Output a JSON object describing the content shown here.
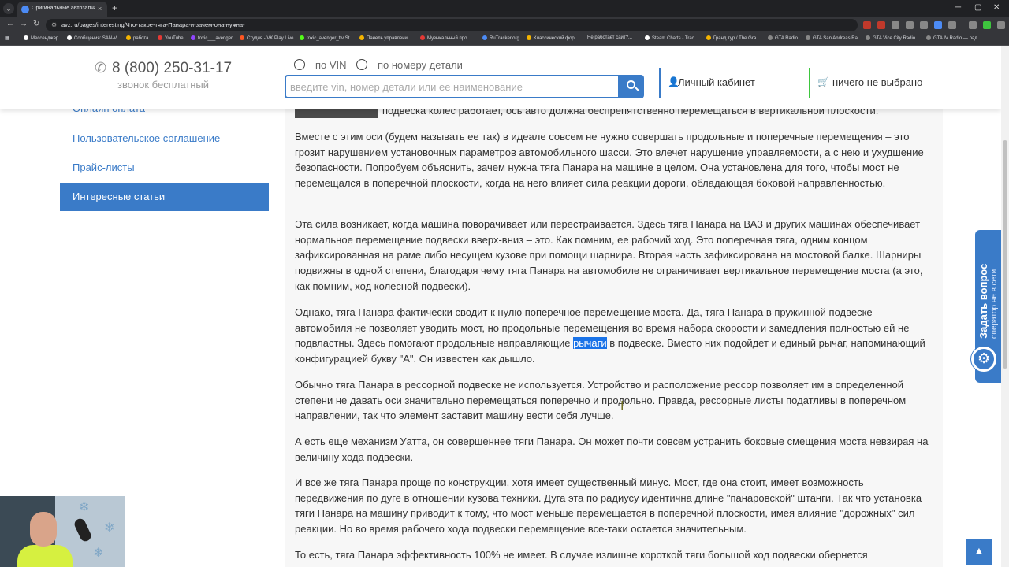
{
  "browser": {
    "tab_title": "Оригинальные автозапчасти и",
    "tab_close": "×",
    "tab_new": "+",
    "menu_glyph": "⌄",
    "url": "avz.ru/pages/interesting/Что-такое-тяга-Панара-и-зачем-она-нужна-",
    "bookmarks": [
      "Мессенджер",
      "Сообщения: SAN-V...",
      "работа",
      "YouTube",
      "toxic___avenger",
      "Студия - VK Play Live",
      "toxic_avenger_ttv St...",
      "Панель управлени...",
      "Музыкальный про...",
      "RuTracker.org",
      "Классический фор...",
      "Не работает сайт?...",
      "Steam Charts - Trac...",
      "Гранд тур / The Gra...",
      "GTA Radio",
      "GTA San Andreas Ra...",
      "GTA Vice City Radio...",
      "GTA IV Radio — рад..."
    ],
    "colors": {
      "chrome_dark": "#202124",
      "chrome_mid": "#35363a"
    }
  },
  "header": {
    "phone": "8 (800) 250-31-17",
    "phone_sub": "звонок бесплатный",
    "radio_vin": "по VIN",
    "radio_part": "по номеру детали",
    "search_placeholder": "введите vin, номер детали или ее наименование",
    "cabinet": "Личный кабинет",
    "cart": "ничего не выбрано",
    "accent": "#3a7bc8",
    "cart_accent": "#3ec63e"
  },
  "sidebar": {
    "items": [
      {
        "label": "Онлайн оплата",
        "active": false
      },
      {
        "label": "Пользовательское соглашение",
        "active": false
      },
      {
        "label": "Прайс-листы",
        "active": false
      },
      {
        "label": "Интересные статьи",
        "active": true
      }
    ]
  },
  "article": {
    "p0": "подвеска колес работает, ось авто должна беспрепятственно перемещаться в вертикальной плоскости.",
    "p1": "Вместе с этим оси (будем называть ее так) в идеале совсем не нужно совершать продольные и поперечные перемещения – это грозит нарушением установочных параметров автомобильного шасси. Это влечет нарушение управляемости, а с нею и ухудшение безопасности. Попробуем объяснить, зачем нужна тяга Панара на машине в целом. Она установлена для того, чтобы мост не перемещался в поперечной плоскости, когда на него влияет сила реакции дороги, обладающая боковой направленностью.",
    "p2": "Эта сила возникает, когда машина поворачивает или перестраивается. Здесь тяга Панара на ВАЗ и других машинах обеспечивает нормальное перемещение подвески вверх-вниз – это. Как помним, ее рабочий ход. Это поперечная тяга, одним концом зафиксированная на раме либо несущем кузове при помощи шарнира. Вторая часть зафиксирована на мостовой балке. Шарниры подвижны в одной степени, благодаря чему тяга Панара на автомобиле не ограничивает вертикальное перемещение моста (а это, как помним, ход колесной подвески).",
    "p3_before": "Однако, тяга Панара фактически сводит к нулю поперечное перемещение моста. Да, тяга Панара в пружинной подвеске автомобиля не позволяет уводить мост, но продольные перемещения во время набора скорости и замедления полностью ей не подвластны. Здесь помогают продольные направляющие ",
    "p3_highlight": "рычаги",
    "p3_after": " в подвеске. Вместо них подойдет и единый рычаг, напоминающий конфигурацией букву \"А\". Он известен как дышло.",
    "p4": "Обычно тяга Панара в рессорной подвеске не используется. Устройство и расположение рессор позволяет им в определенной степени не давать оси значительно перемещаться поперечно и продольно. Правда, рессорные листы податливы в поперечном направлении, так что элемент заставит машину вести себя лучше.",
    "p5": "А есть еще механизм Уатта, он совершеннее тяги Панара. Он может почти совсем устранить боковые смещения моста невзирая на величину хода подвески.",
    "p6": "И все же тяга Панара проще по конструкции, хотя имеет существенный минус. Мост, где она стоит, имеет возможность передвижения по дуге в отношении кузова техники. Дуга эта по радиусу идентична длине \"панаровской\" штанги. Так что установка тяги Панара на машину приводит к тому, что мост меньше перемещается в поперечной плоскости, имея влияние \"дорожных\" сил реакции. Но во время рабочего хода подвески перемещение все-таки остается значительным.",
    "p7": "То есть, тяга Панара эффективность 100% не имеет. В случае излишне короткой тяги большой ход подвески обернется"
  },
  "widget": {
    "ask_title": "Задать вопрос",
    "ask_sub": "оператор не в сети",
    "to_top": "▲"
  }
}
